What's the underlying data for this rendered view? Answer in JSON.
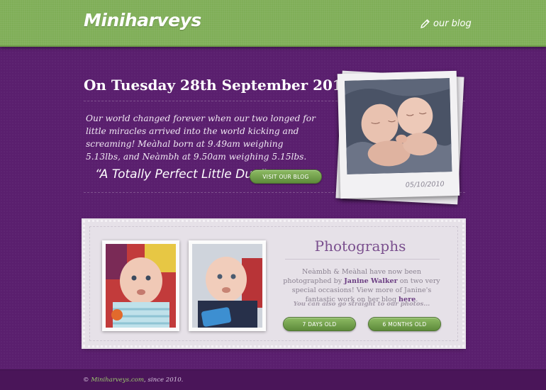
{
  "header": {
    "logo": "Miniharveys",
    "blog_link": "our blog",
    "blog_icon": "pencil-icon",
    "bg_color": "#7fae57"
  },
  "intro": {
    "headline": "On Tuesday 28th September 2010...",
    "paragraph": "Our world changed forever when our two longed for little miracles arrived into the world kicking and screaming! Meàhal born at 9.49am weighing 5.13lbs, and Neàmbh at 9.50am weighing 5.15lbs.",
    "quote": "“A Totally Perfect Little Duo”",
    "visit_button": "VISIT OUR BLOG",
    "polaroid_date": "05/10/2010"
  },
  "photographs": {
    "title": "Photographs",
    "text_before_name": "Neàmbh & Meàhal have now been photographed by",
    "photographer": "Janine Walker",
    "text_after_name": "on two very special occasions! View more of Janine's fantastic work on her blog",
    "here_link": "here",
    "note": "You can also go straight to our photos...",
    "buttons": [
      "7 DAYS OLD",
      "6 MONTHS OLD"
    ]
  },
  "footer": {
    "copyright": "©",
    "site": "Miniharveys.com",
    "since": ", since 2010."
  },
  "colors": {
    "background": "#5a1f6e",
    "accent_green": "#7fae57",
    "title_purple": "#7a4f8e"
  }
}
